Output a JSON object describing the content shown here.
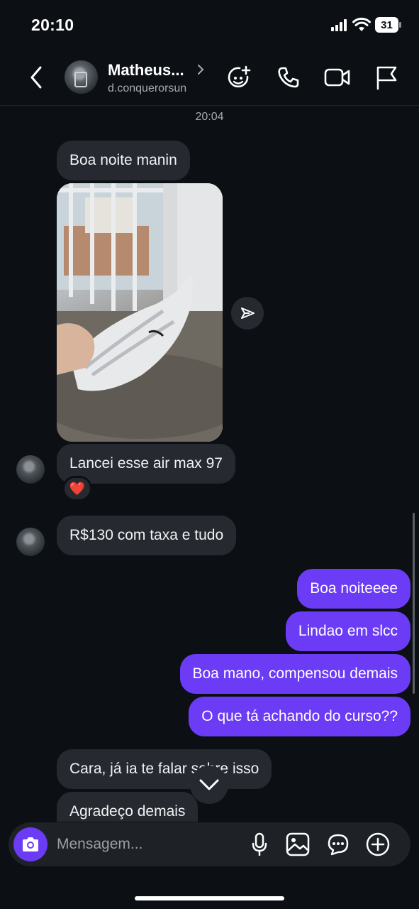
{
  "status_bar": {
    "time": "20:10",
    "battery": "31"
  },
  "header": {
    "name": "Matheus...",
    "username": "d.conquerorsun"
  },
  "timestamp": "20:04",
  "messages": {
    "m1": "Boa noite manin",
    "m2": "Lancei esse air max 97",
    "m2_reaction": "❤️",
    "m3": "R$130 com taxa e tudo",
    "o1": "Boa noiteeee",
    "o2": "Lindao em slcc",
    "o3": "Boa mano, compensou demais",
    "o4": "O que tá achando do curso??",
    "m4": "Cara, já ia te falar sobre isso",
    "m5": "Agradeço demais"
  },
  "composer": {
    "placeholder": "Mensagem..."
  },
  "colors": {
    "accent": "#6b3bf5",
    "incoming_bubble": "#262a30",
    "background": "#0c1014"
  }
}
